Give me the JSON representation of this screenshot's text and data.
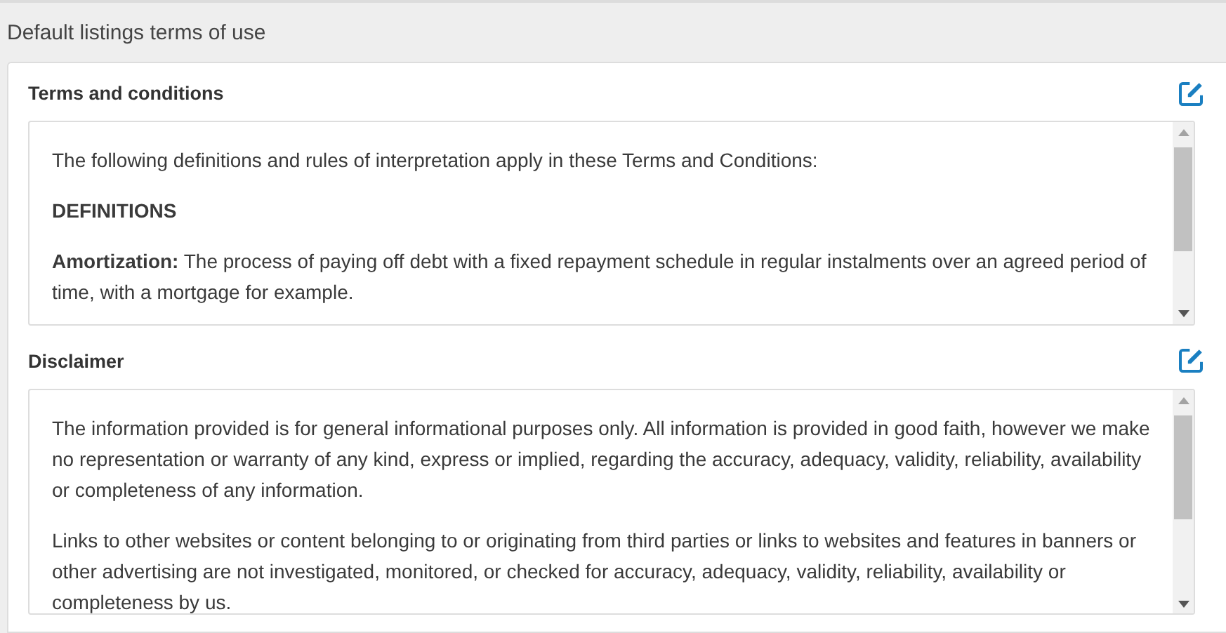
{
  "page_title": "Default listings terms of use",
  "sections": [
    {
      "title": "Terms and conditions",
      "paragraphs": [
        {
          "kind": "text",
          "text": "The following definitions and rules of interpretation apply in these Terms and Conditions:"
        },
        {
          "kind": "heading",
          "text": "DEFINITIONS"
        },
        {
          "kind": "text",
          "text": "**Amortization:** The process of paying off debt with a fixed repayment schedule in regular instalments over an agreed period of time, with a mortgage for example."
        }
      ]
    },
    {
      "title": "Disclaimer",
      "paragraphs": [
        {
          "kind": "text",
          "text": "The information provided is for general informational purposes only. All information is provided in good faith, however we make no representation or warranty of any kind, express or implied, regarding the accuracy, adequacy, validity, reliability, availability or completeness of any information."
        },
        {
          "kind": "text",
          "text": "Links to other websites or content belonging to or originating from third parties or links to websites and features in banners or other advertising are not investigated, monitored, or checked for accuracy, adequacy, validity, reliability, availability or completeness by us."
        }
      ]
    }
  ]
}
